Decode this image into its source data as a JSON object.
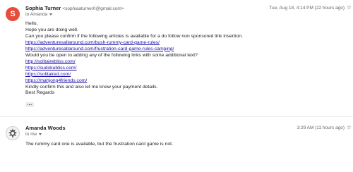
{
  "messages": [
    {
      "sender": "Sophia Turner",
      "email": "<sophiaaturner0@gmail.com>",
      "to": "to Amanda",
      "time": "Tue, Aug 18, 4:14 PM (22 hours ago)",
      "avatar_letter": "S",
      "lines": [
        {
          "text": "Hello,",
          "link": false
        },
        {
          "text": "Hope you are doing well.",
          "link": false
        },
        {
          "text": "Can you please confirm if the following articles is available for a do follow non sponsored link insertion.",
          "link": false
        },
        {
          "text": "https://adventuresallaround.com/bush-rummy-card-game-rules/",
          "link": true
        },
        {
          "text": "https://adventuresallaround.com/frustration-card-game-rules-camping/",
          "link": true
        },
        {
          "text": "Would you be open to adding any of the following links with some additional text?",
          "link": false
        },
        {
          "text": "http://solitairebliss.com/",
          "link": true
        },
        {
          "text": "https://sudokubliss.com/",
          "link": true
        },
        {
          "text": "https://solitaired.com/",
          "link": true
        },
        {
          "text": "https://mahjong4friends.com/",
          "link": true
        },
        {
          "text": "Kindly confirm this and also let me know your payment details.",
          "link": false
        },
        {
          "text": "Best Regards",
          "link": false
        }
      ]
    },
    {
      "sender": "Amanda Woods",
      "to": "to me",
      "time": "3:29 AM (11 hours ago)",
      "body": "The rummy card one is available, but the frustration card game is not."
    }
  ],
  "colors": {
    "link": "#1a0dab",
    "avatar_sophia": "#e74c3c"
  },
  "icons": {
    "star": "star-icon",
    "caret": "caret-down-icon",
    "ellipsis": "show-trimmed-content-icon"
  }
}
